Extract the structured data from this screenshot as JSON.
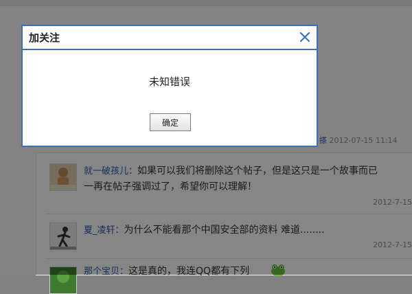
{
  "dialog": {
    "title": "加关注",
    "message": "未知错误",
    "ok_label": "确定",
    "close_icon": "close-icon",
    "accent_color": "#3e6fb5"
  },
  "thread": {
    "header_tail": "搽",
    "header_date": "2012-07-15 11:14"
  },
  "replies": [
    {
      "author": "就一破孩儿",
      "text_line1": "如果可以我们将删除这个帖子，但是这只是一个故事而已",
      "text_line2": "一再在帖子强调过了，希望你可以理解！",
      "date": "2012-7-15"
    },
    {
      "author": "夏_凌轩",
      "text_line1": "为什么不能看那个中国安全部的资料  难道........",
      "date": "2012-7-15"
    },
    {
      "author": "那个宝贝",
      "text_line1": "这是真的，我连QQ都有下列"
    }
  ]
}
